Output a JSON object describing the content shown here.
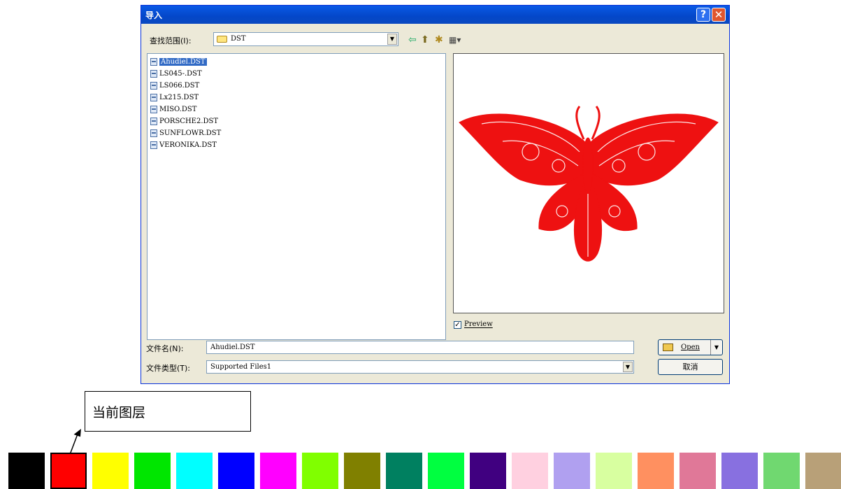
{
  "dialog": {
    "title": "导入",
    "help_glyph": "?",
    "close_glyph": "✕",
    "lookin_label": "查找范围(I):",
    "lookin_value": "DST",
    "files": [
      "Ahudiel.DST",
      "LS045-.DST",
      "LS066.DST",
      "Lx215.DST",
      "MISO.DST",
      "PORSCHE2.DST",
      "SUNFLOWR.DST",
      "VERONIKA.DST"
    ],
    "selected_index": 0,
    "preview_label": "Preview",
    "preview_checked": true,
    "filename_label": "文件名(N):",
    "filename_value": "Ahudiel.DST",
    "filetype_label": "文件类型(T):",
    "filetype_value": "Supported Files1",
    "open_label": "Open",
    "cancel_label": "取消",
    "icons": [
      "back-arrow-icon",
      "up-folder-icon",
      "new-folder-icon",
      "view-menu-icon"
    ]
  },
  "callout": {
    "text": "当前图层"
  },
  "palette": {
    "colors": [
      "#000000",
      "#ff0000",
      "#ffff00",
      "#00e600",
      "#00ffff",
      "#0000ff",
      "#ff00ff",
      "#80ff00",
      "#808000",
      "#008060",
      "#00ff40",
      "#400080",
      "#ffd0e0",
      "#b0a0f0",
      "#d8ffa0",
      "#ff9060",
      "#e07898",
      "#8870e0",
      "#70d870",
      "#b8a078"
    ],
    "current_index": 1
  }
}
